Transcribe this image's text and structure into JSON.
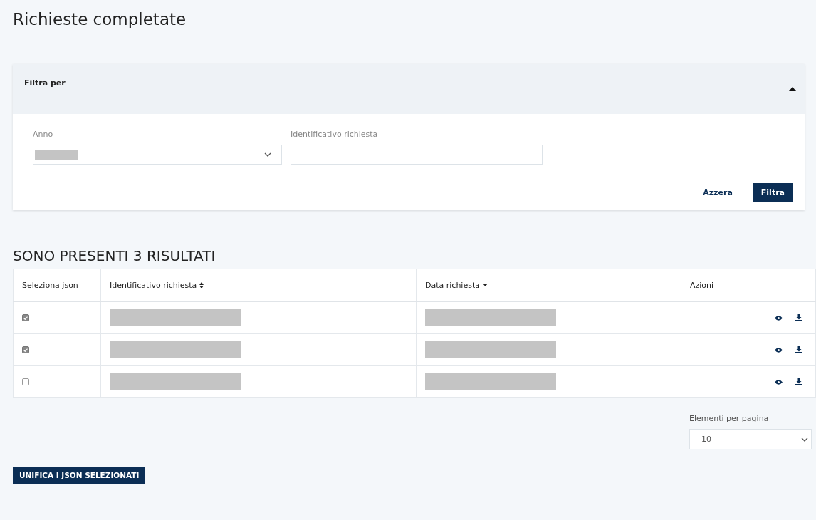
{
  "page_title": "Richieste completate",
  "filter": {
    "title": "Filtra per",
    "expanded": true,
    "fields": [
      {
        "kind": "select",
        "label": "Anno",
        "value_redacted": true
      },
      {
        "kind": "text",
        "label": "Identificativo richiesta"
      }
    ],
    "buttons": [
      {
        "kind": "link",
        "label": "Azzera"
      },
      {
        "kind": "primary",
        "label": "Filtra"
      }
    ]
  },
  "results": {
    "heading": "SONO PRESENTI 3 RISULTATI",
    "columns": [
      {
        "label": "Seleziona json",
        "sortable": false
      },
      {
        "label": "Identificativo richiesta",
        "sortable": true,
        "sorted_desc": false
      },
      {
        "label": "Data richiesta",
        "sortable": true,
        "sorted_desc": true
      },
      {
        "label": "Azioni",
        "sortable": false
      }
    ],
    "rows": [
      {
        "checked": true
      },
      {
        "checked": true
      },
      {
        "checked": false
      }
    ]
  },
  "pager": {
    "label": "Elementi per pagina",
    "value": "10"
  },
  "merge_button": "UNIFICA I JSON SELEZIONATI"
}
